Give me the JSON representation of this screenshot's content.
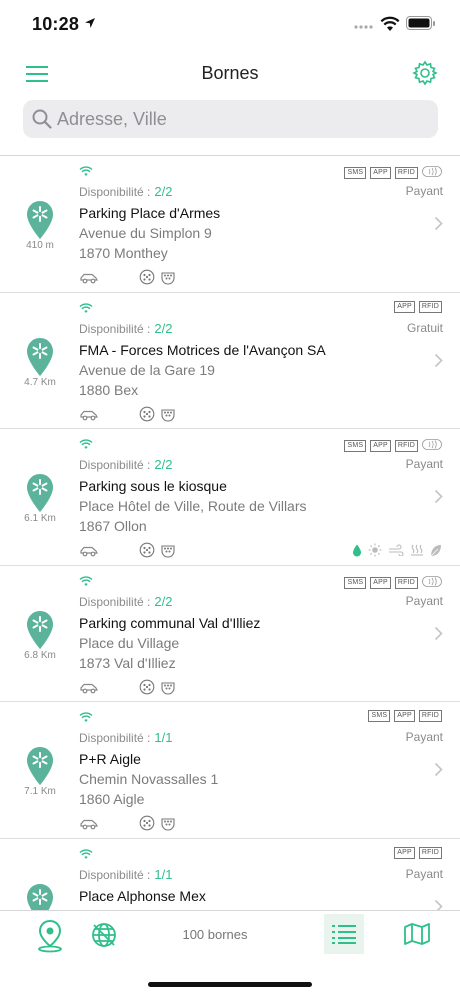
{
  "status": {
    "time": "10:28"
  },
  "nav": {
    "title": "Bornes"
  },
  "search": {
    "placeholder": "Adresse, Ville"
  },
  "colors": {
    "accent": "#2fbf8a",
    "pin": "#5ab39a"
  },
  "stations": [
    {
      "distance": "410 m",
      "availability_label": "Disponibilité :",
      "availability": "2/2",
      "price": "Payant",
      "name": "Parking Place d'Armes",
      "street": "Avenue du Simplon 9",
      "city": "1870 Monthey",
      "tags": [
        "SMS",
        "APP",
        "RFID"
      ],
      "contactless": true,
      "amenities": false
    },
    {
      "distance": "4.7 Km",
      "availability_label": "Disponibilité :",
      "availability": "2/2",
      "price": "Gratuit",
      "name": "FMA - Forces Motrices de l'Avançon SA",
      "street": "Avenue de la Gare 19",
      "city": "1880 Bex",
      "tags": [
        "APP",
        "RFID"
      ],
      "contactless": false,
      "amenities": false
    },
    {
      "distance": "6.1 Km",
      "availability_label": "Disponibilité :",
      "availability": "2/2",
      "price": "Payant",
      "name": "Parking sous le kiosque",
      "street": "Place Hôtel de Ville, Route de Villars",
      "city": "1867 Ollon",
      "tags": [
        "SMS",
        "APP",
        "RFID"
      ],
      "contactless": true,
      "amenities": true
    },
    {
      "distance": "6.8 Km",
      "availability_label": "Disponibilité :",
      "availability": "2/2",
      "price": "Payant",
      "name": "Parking communal Val d'Illiez",
      "street": "Place du Village",
      "city": "1873 Val d'Illiez",
      "tags": [
        "SMS",
        "APP",
        "RFID"
      ],
      "contactless": true,
      "amenities": false
    },
    {
      "distance": "7.1 Km",
      "availability_label": "Disponibilité :",
      "availability": "1/1",
      "price": "Payant",
      "name": "P+R Aigle",
      "street": "Chemin Novassalles 1",
      "city": "1860 Aigle",
      "tags": [
        "SMS",
        "APP",
        "RFID"
      ],
      "contactless": false,
      "amenities": false
    },
    {
      "distance": "",
      "availability_label": "Disponibilité :",
      "availability": "1/1",
      "price": "Payant",
      "name": "Place Alphonse Mex",
      "street": "",
      "city": "",
      "tags": [
        "APP",
        "RFID"
      ],
      "contactless": false,
      "amenities": false
    }
  ],
  "bottom_bar": {
    "count": "100 bornes"
  }
}
